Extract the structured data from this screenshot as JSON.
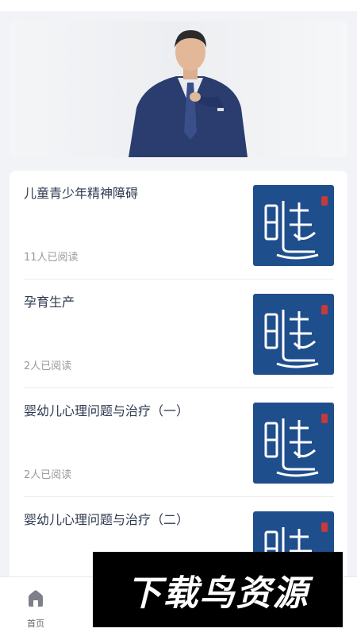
{
  "articles": [
    {
      "title": "儿童青少年精神障碍",
      "reads": "11人已阅读"
    },
    {
      "title": "孕育生产",
      "reads": "2人已阅读"
    },
    {
      "title": "婴幼儿心理问题与治疗（一）",
      "reads": "2人已阅读"
    },
    {
      "title": "婴幼儿心理问题与治疗（二）",
      "reads": ""
    }
  ],
  "tabbar": {
    "home_label": "首页"
  },
  "watermark": {
    "text": "下载鸟资源"
  },
  "colors": {
    "thumb_bg": "#1f4e8c",
    "page_bg": "#f2f3f6"
  }
}
